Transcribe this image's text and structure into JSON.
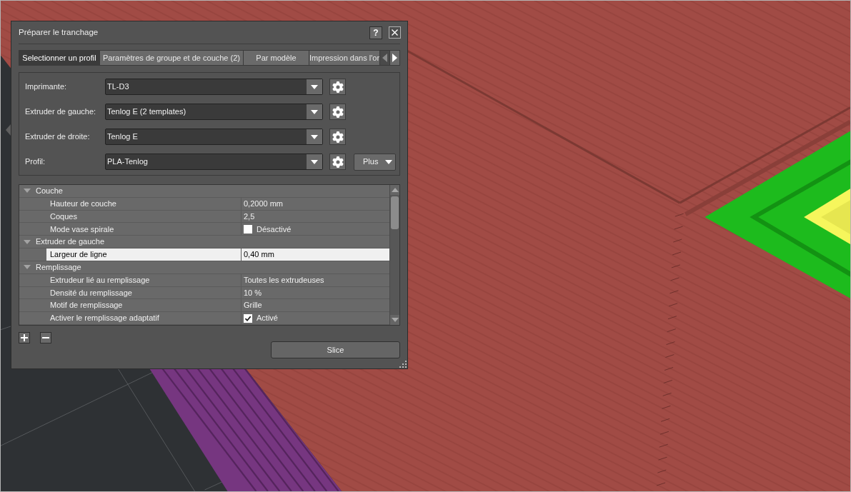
{
  "dialog": {
    "title": "Préparer le tranchage",
    "help_label": "?"
  },
  "tabs": [
    {
      "label": "Selectionner un profil",
      "selected": true
    },
    {
      "label": "Paramètres de groupe et de couche (2)",
      "selected": false
    },
    {
      "label": "Par modèle",
      "selected": false
    },
    {
      "label": "Impression dans l'or",
      "selected": false
    }
  ],
  "tab_arrows": [
    {
      "kind": "left",
      "disabled": true
    },
    {
      "kind": "right",
      "disabled": false
    }
  ],
  "profile_fields": [
    {
      "label": "Imprimante:",
      "value": "TL-D3"
    },
    {
      "label": "Extruder de gauche:",
      "value": "Tenlog E (2 templates)"
    },
    {
      "label": "Extruder de droite:",
      "value": "Tenlog E"
    },
    {
      "label": "Profil:",
      "value": "PLA-Tenlog"
    }
  ],
  "more_button": "Plus",
  "properties": [
    {
      "label": "Couche",
      "expanded": true,
      "selected": false,
      "children": [
        {
          "label": "Hauteur de couche",
          "kind": "text",
          "value": "0,2000 mm",
          "selected": false
        },
        {
          "label": "Coques",
          "kind": "text",
          "value": "2,5",
          "selected": false
        },
        {
          "label": "Mode vase spirale",
          "kind": "checkbox",
          "checked": false,
          "value": "Désactivé",
          "selected": false
        }
      ]
    },
    {
      "label": "Extruder de gauche",
      "expanded": true,
      "selected": false,
      "children": [
        {
          "label": "Largeur de ligne",
          "kind": "text",
          "value": "0,40 mm",
          "selected": true
        }
      ]
    },
    {
      "label": "Remplissage",
      "expanded": true,
      "selected": false,
      "children": [
        {
          "label": "Extrudeur lié au remplissage",
          "kind": "text",
          "value": "Toutes les extrudeuses",
          "selected": false
        },
        {
          "label": "Densité du remplissage",
          "kind": "text",
          "value": "10 %",
          "selected": false
        },
        {
          "label": "Motif de remplissage",
          "kind": "text",
          "value": "Grille",
          "selected": false
        },
        {
          "label": "Activer le remplissage adaptatif",
          "kind": "checkbox",
          "checked": true,
          "value": "Activé",
          "selected": false
        }
      ]
    }
  ],
  "slice_button": "Slice"
}
